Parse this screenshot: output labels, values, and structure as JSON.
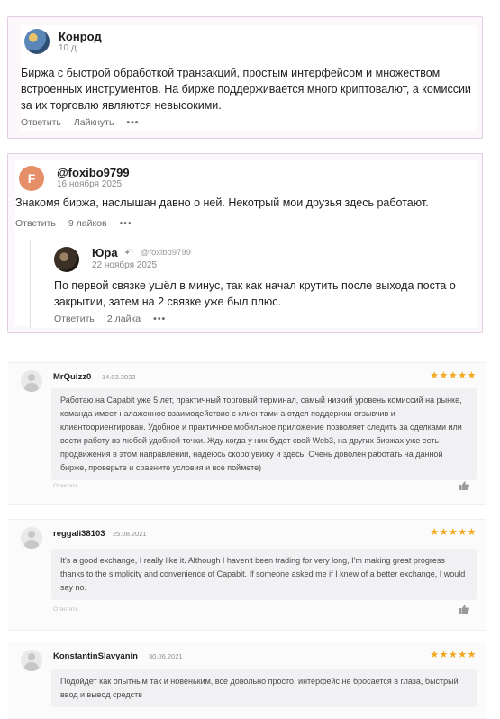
{
  "comments": [
    {
      "user": "Конрод",
      "date": "10 д",
      "text": "Биржа с быстрой обработкой транзакций, простым интерфейсом и множеством встроенных инструментов. На бирже поддерживается много криптовалют, а комиссии за их торговлю являются невысокими.",
      "reply_label": "Ответить",
      "like_label": "Лайкнуть",
      "more": "•••"
    },
    {
      "user": "@foxibo9799",
      "avatar_letter": "F",
      "date": "16 ноября 2025",
      "text": "Знакомя биржа, наслышан давно о ней. Некотрый мои друзья здесь работают.",
      "reply_label": "Ответить",
      "like_label": "9 лайков",
      "more": "•••",
      "reply": {
        "user": "Юра",
        "reply_to": "@foxibo9799",
        "date": "22 ноября 2025",
        "text": "По первой связке ушёл в минус, так как начал крутить после выхода поста о закрытии, затем на 2 связке уже был плюс.",
        "reply_label": "Ответить",
        "like_label": "2 лайка",
        "more": "•••"
      }
    }
  ],
  "reviews": [
    {
      "user": "MrQuizz0",
      "date": "14.02.2022",
      "stars": "★★★★★",
      "text": "Работаю на Capabit уже 5 лет, практичный торговый терминал, самый низкий уровень комиссий на рынке, команда имеет налаженное взаимодействие с клиентами а отдел поддержки отзывчив и клиентоориентирован. Удобное и практичное мобильное приложение позволяет следить за сделками или вести работу из любой удобной точки. Жду когда у них будет свой Web3, на других биржах уже есть продвижения в этом направлении, надеюсь скоро увижу и здесь. Очень доволен работать на данной бирже, проверьте и сравните условия и все поймете)",
      "reply_label": "Ответить"
    },
    {
      "user": "reggali38103",
      "date": "25.08.2021",
      "stars": "★★★★★",
      "text": "It's a good exchange, I really like it. Although I haven't been trading for very long, I'm making great progress thanks to the simplicity and convenience of Capabit. If someone asked me if I knew of a better exchange, I would say no.",
      "reply_label": "Ответить"
    },
    {
      "user": "KonstantinSlavyanin",
      "date": "30.06.2021",
      "stars": "★★★★★",
      "text": "Подойдет как опытным так и новеньким, все довольно просто, интерфейс не бросается в глаза, быстрый ввод и вывод средств"
    }
  ],
  "colors": {
    "card_border": "#e2cfe3",
    "star": "#f2a81d",
    "avatar_letter_bg": "#e58f69"
  }
}
